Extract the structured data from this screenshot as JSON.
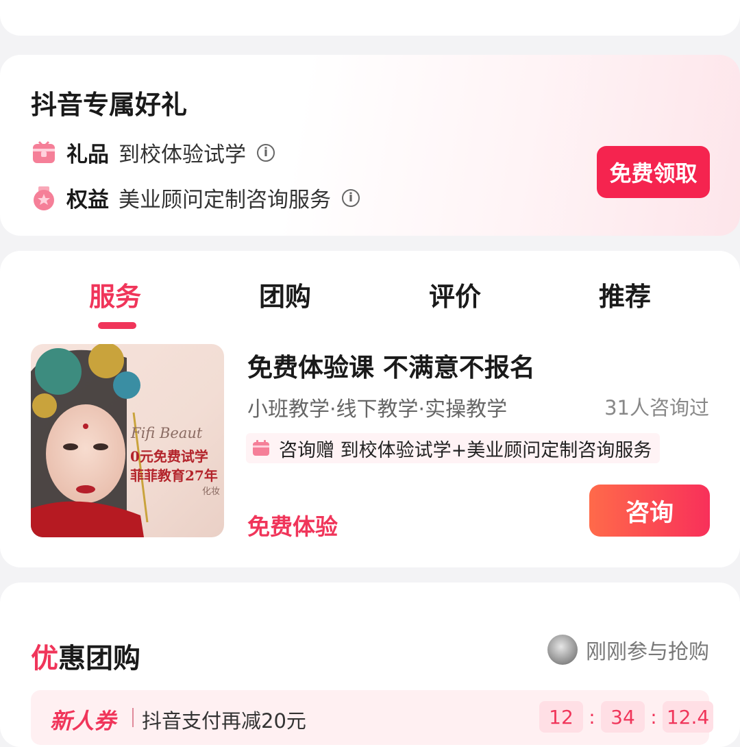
{
  "gift_section": {
    "title": "抖音专属好礼",
    "rows": [
      {
        "kind": "礼品",
        "desc": "到校体验试学"
      },
      {
        "kind": "权益",
        "desc": "美业顾问定制咨询服务"
      }
    ],
    "claim_button": "免费领取"
  },
  "tabs": [
    "服务",
    "团购",
    "评价",
    "推荐"
  ],
  "service": {
    "title": "免费体验课 不满意不报名",
    "subtitle": "小班教学·线下教学·实操教学",
    "consult_count": "31人咨询过",
    "bonus": "咨询赠 到校体验试学+美业顾问定制咨询服务",
    "free_label": "免费体验",
    "consult_button": "咨询",
    "thumb_text": {
      "brand": "Fifi Beaut",
      "line1": "0元免费试学",
      "line2": "菲菲教育27年",
      "tag": "化妆"
    }
  },
  "group_deal": {
    "title_first": "优",
    "title_rest": "惠团购",
    "recent_text": "刚刚参与抢购",
    "coupon_tag": "新人券",
    "coupon_desc": "抖音支付再减20元",
    "timer": [
      "12",
      "34",
      "12.4"
    ]
  },
  "colors": {
    "accent": "#f0355a",
    "claim_button": "#f5244f",
    "consult_gradient": [
      "#ff6a4a",
      "#f8305a"
    ]
  }
}
